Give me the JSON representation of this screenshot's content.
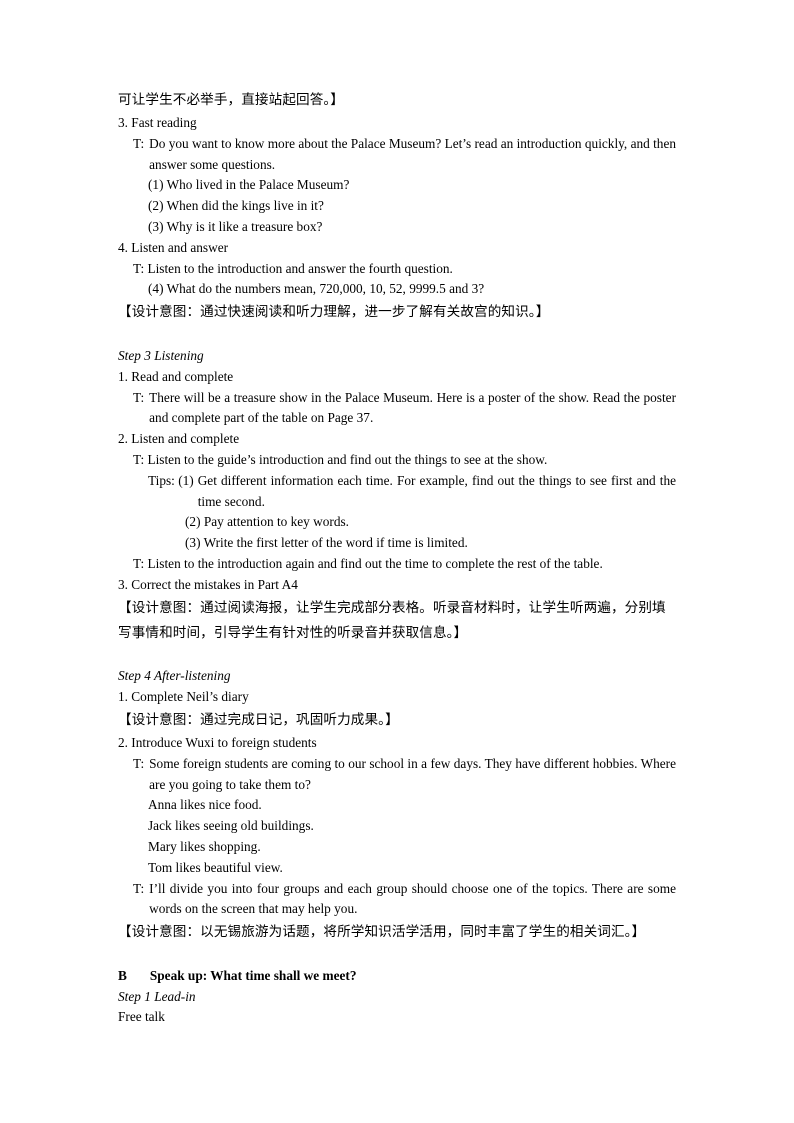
{
  "document": {
    "blocks": [
      {
        "id": "cn_lead_tail",
        "text": "可让学生不必举手，直接站起回答。】"
      },
      {
        "id": "item3_fast_reading",
        "text": "3. Fast reading"
      },
      {
        "id": "t_fast_reading_marker",
        "text": "T:"
      },
      {
        "id": "t_fast_reading_body",
        "text": "Do you want to know more about the Palace Museum? Let’s read an introduction quickly, and then answer some questions."
      },
      {
        "id": "q1",
        "text": "(1) Who lived in the Palace Museum?"
      },
      {
        "id": "q2",
        "text": "(2) When did the kings live in it?"
      },
      {
        "id": "q3",
        "text": "(3) Why is it like a treasure box?"
      },
      {
        "id": "item4_listen_answer",
        "text": "4. Listen and answer"
      },
      {
        "id": "t_listen_answer",
        "text": "T: Listen to the introduction and answer the fourth question."
      },
      {
        "id": "q4",
        "text": "(4) What do the numbers mean, 720,000, 10, 52, 9999.5 and 3?"
      },
      {
        "id": "cn_intent_1",
        "text": "【设计意图：通过快速阅读和听力理解，进一步了解有关故宫的知识。】"
      },
      {
        "id": "step3_heading",
        "text": "Step 3 Listening"
      },
      {
        "id": "s3_item1",
        "text": "1. Read and complete"
      },
      {
        "id": "s3_t1_marker",
        "text": "T:"
      },
      {
        "id": "s3_t1_body",
        "text": "There will be a treasure show in the Palace Museum. Here is a poster of the show. Read the poster and complete part of the table on Page 37."
      },
      {
        "id": "s3_item2",
        "text": "2. Listen and complete"
      },
      {
        "id": "s3_t2",
        "text": "T: Listen to the guide’s introduction and find out the things to see at the show."
      },
      {
        "id": "tips_marker",
        "text": "Tips: (1)"
      },
      {
        "id": "tips_1_body",
        "text": "Get different information each time. For example, find out the things to see first and the time second."
      },
      {
        "id": "tips_2",
        "text": "(2) Pay attention to key words."
      },
      {
        "id": "tips_3",
        "text": "(3) Write the first letter of the word if time is limited."
      },
      {
        "id": "s3_t3",
        "text": "T: Listen to the introduction again and find out the time to complete the rest of the table."
      },
      {
        "id": "s3_item3",
        "text": "3. Correct the mistakes in Part A4"
      },
      {
        "id": "cn_intent_2",
        "text": "【设计意图：通过阅读海报，让学生完成部分表格。听录音材料时，让学生听两遍，分别填写事情和时间，引导学生有针对性的听录音并获取信息。】"
      },
      {
        "id": "step4_heading",
        "text": "Step 4 After-listening"
      },
      {
        "id": "s4_item1",
        "text": "1. Complete Neil’s diary"
      },
      {
        "id": "cn_intent_3",
        "text": "【设计意图：通过完成日记，巩固听力成果。】"
      },
      {
        "id": "s4_item2",
        "text": "2. Introduce Wuxi to foreign students"
      },
      {
        "id": "s4_t1_marker",
        "text": "T:"
      },
      {
        "id": "s4_t1_body",
        "text": "Some foreign students are coming to our school in a few days. They have different hobbies. Where are you going to take them to?"
      },
      {
        "id": "hobby_anna",
        "text": "Anna likes nice food."
      },
      {
        "id": "hobby_jack",
        "text": "Jack likes seeing old buildings."
      },
      {
        "id": "hobby_mary",
        "text": "Mary likes shopping."
      },
      {
        "id": "hobby_tom",
        "text": "Tom likes beautiful view."
      },
      {
        "id": "s4_t2_marker",
        "text": "T:"
      },
      {
        "id": "s4_t2_body",
        "text": "I’ll divide you into four groups and each group should choose one of the topics. There are some words on the screen that may help you."
      },
      {
        "id": "cn_intent_4",
        "text": "【设计意图：以无锡旅游为话题，将所学知识活学活用，同时丰富了学生的相关词汇。】"
      },
      {
        "id": "section_b_letter",
        "text": "B"
      },
      {
        "id": "section_b_title",
        "text": "Speak up: What time shall we meet?"
      },
      {
        "id": "step1_heading",
        "text": "Step 1 Lead-in"
      },
      {
        "id": "free_talk",
        "text": "Free talk"
      }
    ]
  }
}
